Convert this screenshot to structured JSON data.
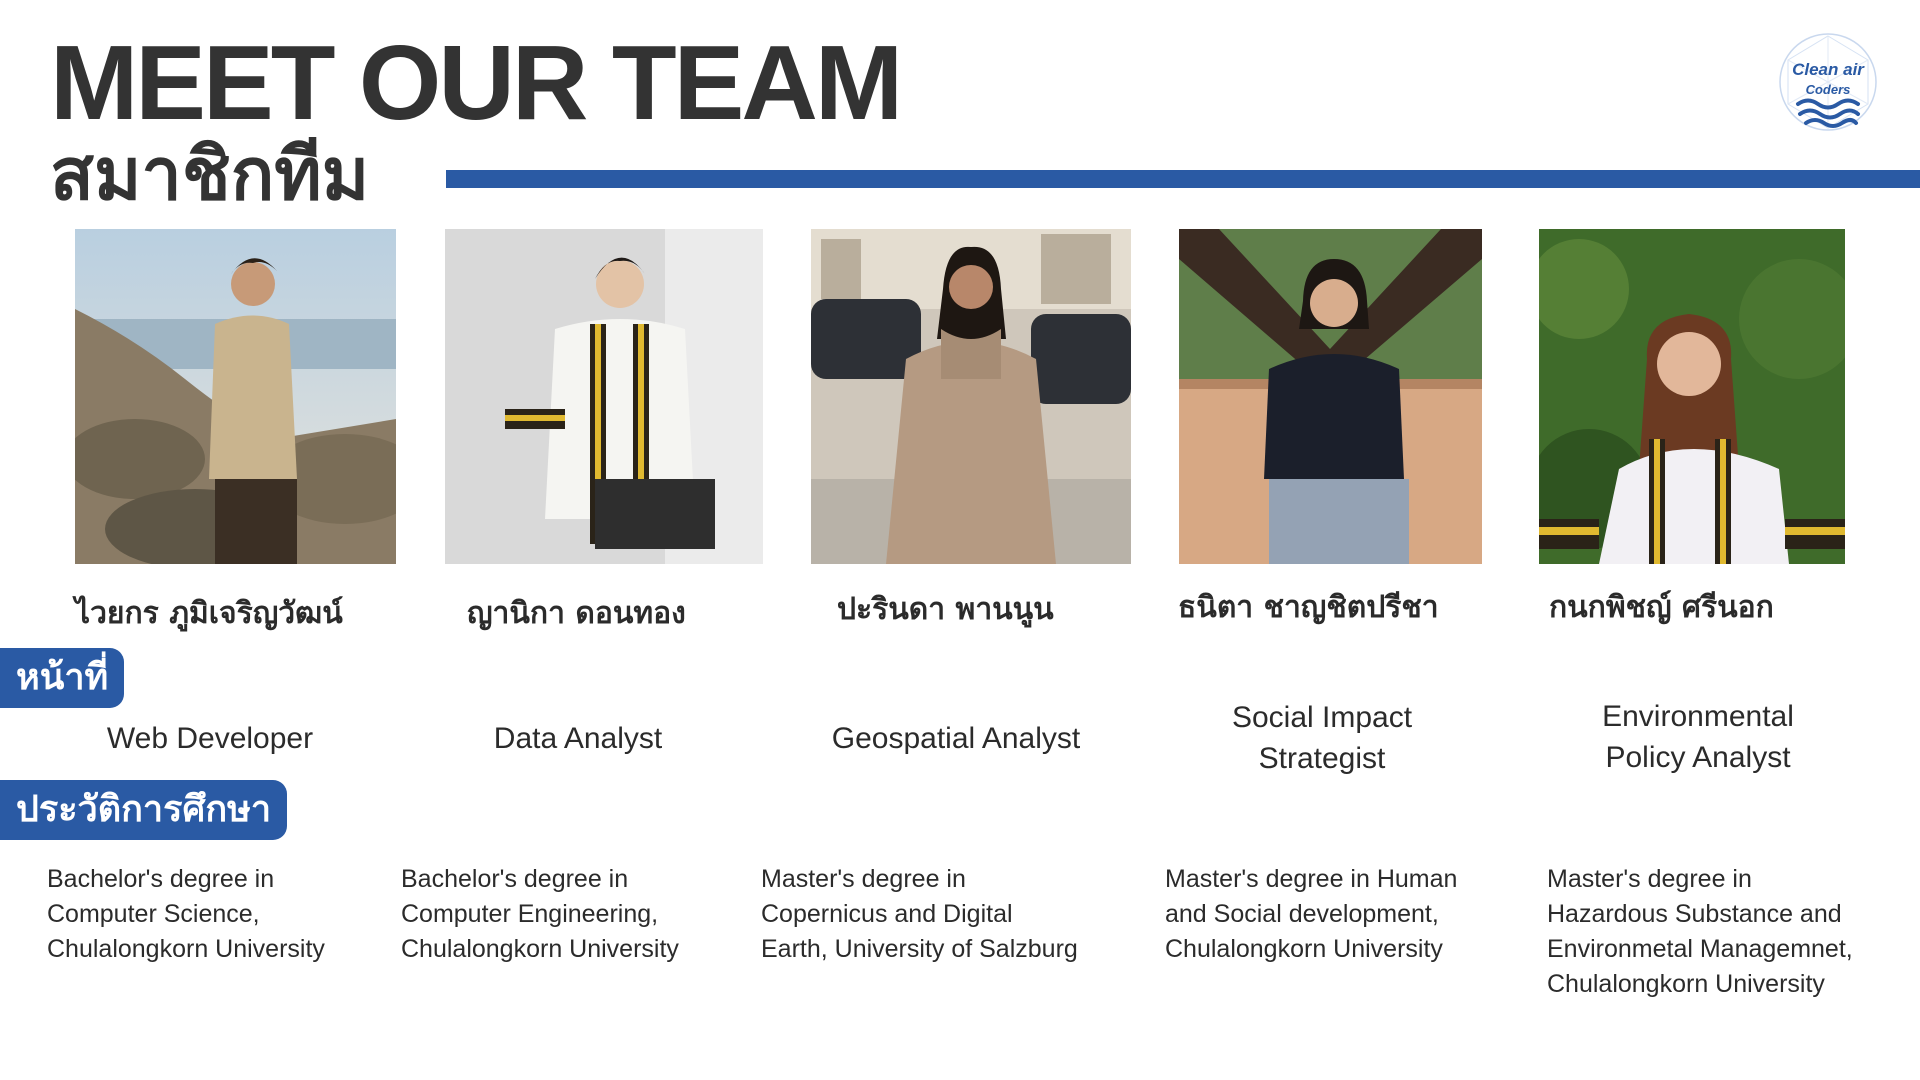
{
  "header": {
    "title_en": "MEET OUR TEAM",
    "title_th": "สมาชิกทีม"
  },
  "logo": {
    "line1": "Clean air",
    "line2": "Coders",
    "icon": "wave-globe-icon"
  },
  "labels": {
    "role": "หน้าที่",
    "education": "ประวัติการศึกษา"
  },
  "colors": {
    "accent": "#2a5aa4",
    "text": "#2b2b2b"
  },
  "members": [
    {
      "name": "ไวยกร ภูมิเจริญวัฒน์",
      "role": [
        "Web Developer"
      ],
      "education": [
        "Bachelor's degree in",
        "Computer Science,",
        "Chulalongkorn University"
      ]
    },
    {
      "name": "ญานิกา ดอนทอง",
      "role": [
        "Data Analyst"
      ],
      "education": [
        "Bachelor's degree in",
        "Computer Engineering,",
        "Chulalongkorn University"
      ]
    },
    {
      "name": "ปะรินดา พานนูน",
      "role": [
        "Geospatial Analyst"
      ],
      "education": [
        "Master's degree in",
        "Copernicus and Digital",
        "Earth, University of Salzburg"
      ]
    },
    {
      "name": "ธนิตา ชาญชิตปรีชา",
      "role": [
        "Social Impact",
        "Strategist"
      ],
      "education": [
        "Master's degree in Human",
        "and Social development,",
        "Chulalongkorn University"
      ]
    },
    {
      "name": "กนกพิชญ์ ศรีนอก",
      "role": [
        "Environmental",
        "Policy Analyst"
      ],
      "education": [
        "Master's degree in",
        "Hazardous Substance and",
        "Environmetal Managemnet,",
        "Chulalongkorn University"
      ]
    }
  ]
}
